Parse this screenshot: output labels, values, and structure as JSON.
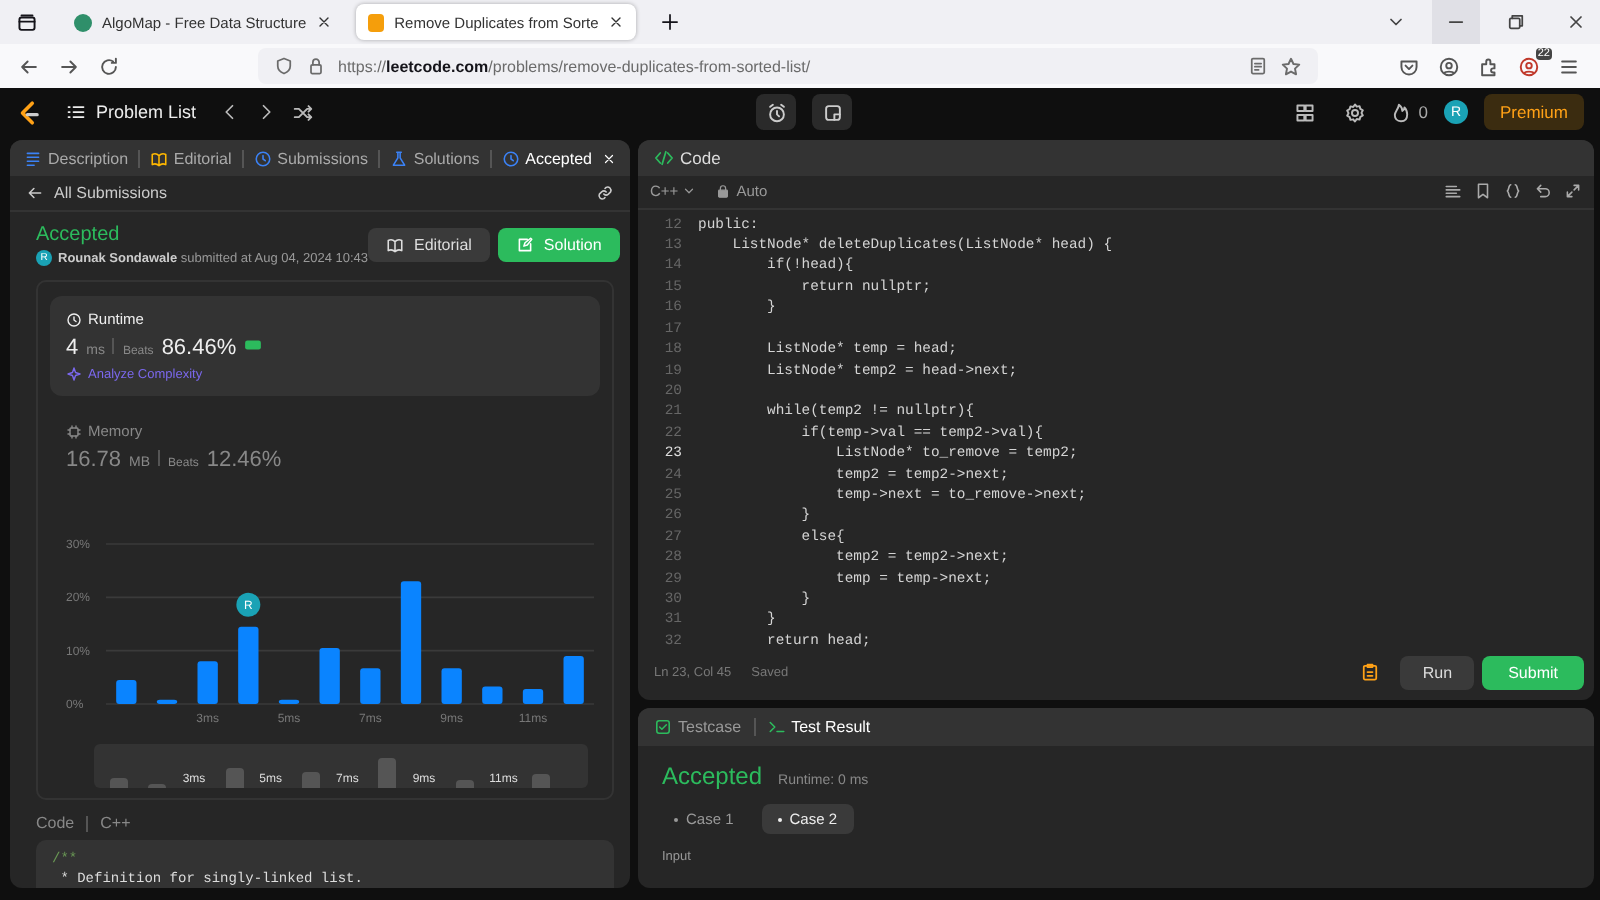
{
  "browser": {
    "tabs": [
      {
        "title": "AlgoMap - Free Data Structure",
        "selected": false
      },
      {
        "title": "Remove Duplicates from Sorte",
        "selected": true
      }
    ],
    "url": "https://**leetcode.com**/problems/remove-duplicates-from-sorted-list/",
    "extension_badge": "22"
  },
  "topbar": {
    "problem_list": "Problem List",
    "streak": "0",
    "avatar": "R",
    "premium": "Premium"
  },
  "left_panel": {
    "tabs": [
      {
        "label": "Description",
        "kind": "description",
        "selected": false
      },
      {
        "label": "Editorial",
        "kind": "editorial",
        "selected": false
      },
      {
        "label": "Submissions",
        "kind": "submissions",
        "selected": false
      },
      {
        "label": "Solutions",
        "kind": "solutions",
        "selected": false
      },
      {
        "label": "Accepted",
        "kind": "accepted",
        "selected": true
      }
    ],
    "back": "All Submissions",
    "status": "Accepted",
    "avatar": "R",
    "author": "Rounak Sondawale",
    "submitted": "submitted at Aug 04, 2024 10:43",
    "editorial_button": "Editorial",
    "solution_button": "Solution",
    "metrics": [
      {
        "kind": "runtime",
        "title": "Runtime",
        "value": "4",
        "unit": "ms",
        "beats_label": "Beats",
        "beats": "86.46%",
        "analyze": "Analyze Complexity",
        "selected": true
      },
      {
        "kind": "memory",
        "title": "Memory",
        "value": "16.78",
        "unit": "MB",
        "beats_label": "Beats",
        "beats": "12.46%",
        "selected": false
      }
    ],
    "chart_data": {
      "type": "bar",
      "x": [
        1,
        2,
        3,
        4,
        5,
        6,
        7,
        8,
        9,
        10,
        11,
        12
      ],
      "xlim": [
        0.5,
        12.5
      ],
      "series": [
        {
          "color": "#0a84ff",
          "values": [
            4.5,
            0.8,
            8,
            14.5,
            0.8,
            10.5,
            6.7,
            23,
            6.7,
            3.3,
            2.8,
            9
          ]
        }
      ],
      "ylim": [
        0,
        30
      ],
      "yticks": [
        {
          "value": 0,
          "label": "0%"
        },
        {
          "value": 10,
          "label": "10%"
        },
        {
          "value": 20,
          "label": "20%"
        },
        {
          "value": 30,
          "label": "30%"
        }
      ],
      "xticks": [
        {
          "value": 3,
          "label": "3ms"
        },
        {
          "value": 5,
          "label": "5ms"
        },
        {
          "value": 7,
          "label": "7ms"
        },
        {
          "value": 9,
          "label": "9ms"
        },
        {
          "value": 11,
          "label": "11ms"
        }
      ],
      "annotations": [
        {
          "x": 4,
          "text": "R"
        }
      ]
    },
    "minimap_labels": [
      "3ms",
      "5ms",
      "7ms",
      "9ms",
      "11ms"
    ],
    "code_label": "Code",
    "code_language": "C++",
    "code_lines": [
      "/**",
      " * Definition for singly-linked list."
    ]
  },
  "editor": {
    "title": "Code",
    "language": "C++",
    "mode": "Auto",
    "lines": [
      {
        "n": "12",
        "text": "public:",
        "current": false
      },
      {
        "n": "13",
        "text": "    ListNode* deleteDuplicates(ListNode* head) {",
        "current": false
      },
      {
        "n": "14",
        "text": "        if(!head){",
        "current": false
      },
      {
        "n": "15",
        "text": "            return nullptr;",
        "current": false
      },
      {
        "n": "16",
        "text": "        }",
        "current": false
      },
      {
        "n": "17",
        "current": false
      },
      {
        "n": "18",
        "text": "        ListNode* temp = head;",
        "current": false
      },
      {
        "n": "19",
        "text": "        ListNode* temp2 = head->next;",
        "current": false
      },
      {
        "n": "20",
        "current": false
      },
      {
        "n": "21",
        "text": "        while(temp2 != nullptr){",
        "current": false
      },
      {
        "n": "22",
        "text": "            if(temp->val == temp2->val){",
        "current": false
      },
      {
        "n": "23",
        "text": "                ListNode* to_remove = temp2;",
        "current": true
      },
      {
        "n": "24",
        "text": "                temp2 = temp2->next;",
        "current": false
      },
      {
        "n": "25",
        "text": "                temp->next = to_remove->next;",
        "current": false
      },
      {
        "n": "26",
        "text": "            }",
        "current": false
      },
      {
        "n": "27",
        "text": "            else{",
        "current": false
      },
      {
        "n": "28",
        "text": "                temp2 = temp2->next;",
        "current": false
      },
      {
        "n": "29",
        "text": "                temp = temp->next;",
        "current": false
      },
      {
        "n": "30",
        "text": "            }",
        "current": false
      },
      {
        "n": "31",
        "text": "        }",
        "current": false
      },
      {
        "n": "32",
        "text": "        return head;",
        "current": false
      }
    ],
    "position": "Ln 23, Col 45",
    "saved": "Saved",
    "run": "Run",
    "submit": "Submit"
  },
  "result": {
    "tabs": [
      {
        "label": "Testcase",
        "kind": "testcase",
        "selected": false
      },
      {
        "label": "Test Result",
        "kind": "result",
        "selected": true
      }
    ],
    "verdict": "Accepted",
    "runtime": "Runtime: 0 ms",
    "cases": [
      {
        "label": "Case 1",
        "selected": false
      },
      {
        "label": "Case 2",
        "selected": true
      }
    ],
    "input_label": "Input"
  }
}
